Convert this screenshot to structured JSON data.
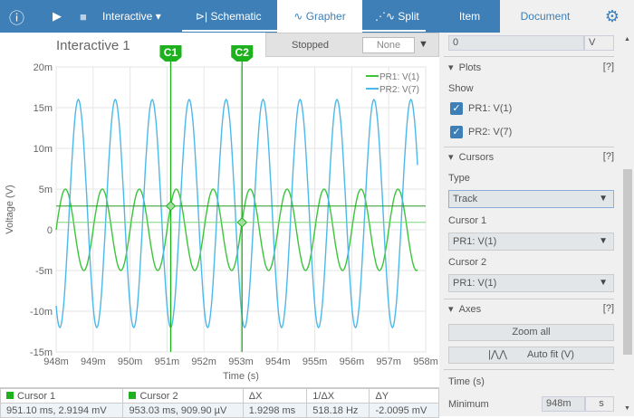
{
  "toolbar": {
    "mode": "Interactive",
    "tabs": [
      "Schematic",
      "Grapher",
      "Split"
    ]
  },
  "right_tabs": {
    "item": "Item",
    "document": "Document"
  },
  "status": {
    "state": "Stopped",
    "select": "None"
  },
  "chart_title": "Interactive 1",
  "cursors": {
    "c1": "C1",
    "c2": "C2"
  },
  "chart_data": {
    "type": "line",
    "xlabel": "Time (s)",
    "ylabel": "Voltage (V)",
    "xlim": [
      0.948,
      0.958
    ],
    "ylim": [
      -0.015,
      0.02
    ],
    "xticks": [
      "948m",
      "949m",
      "950m",
      "951m",
      "952m",
      "953m",
      "954m",
      "955m",
      "956m",
      "957m",
      "958m"
    ],
    "yticks": [
      "20m",
      "15m",
      "10m",
      "5m",
      "0",
      "-5m",
      "-10m",
      "-15m"
    ],
    "grid": true,
    "legend": "top-right",
    "x_end": 0.9578,
    "series": [
      {
        "name": "PR1: V(1)",
        "color": "#3cc43c",
        "model": "sine",
        "offset_mV": 0,
        "amplitude_mV": 5,
        "frequency_hz": 1000,
        "phase_zero_s": 0.948
      },
      {
        "name": "PR2: V(7)",
        "color": "#4db8ea",
        "model": "cosine",
        "offset_mV": 2,
        "amplitude_mV": 14,
        "frequency_hz": 1000,
        "peak_at_s": 0.9486
      }
    ],
    "cursor_values": [
      {
        "t_ms": 951.1,
        "v_mV": 2.9194
      },
      {
        "t_ms": 953.03,
        "v_mV": 0.9099
      }
    ]
  },
  "table": {
    "headers": [
      "Cursor 1",
      "Cursor 2",
      "ΔX",
      "1/ΔX",
      "ΔY"
    ],
    "values": [
      "951.10 ms, 2.9194 mV",
      "953.03 ms, 909.90 µV",
      "1.9298 ms",
      "518.18 Hz",
      "-2.0095 mV"
    ]
  },
  "side": {
    "top_value": "0",
    "top_unit": "V",
    "plots": {
      "title": "Plots",
      "help": "[?]",
      "show": "Show",
      "items": [
        "PR1: V(1)",
        "PR2: V(7)"
      ]
    },
    "cursors": {
      "title": "Cursors",
      "help": "[?]",
      "type_label": "Type",
      "type": "Track",
      "c1_label": "Cursor 1",
      "c1": "PR1: V(1)",
      "c2_label": "Cursor 2",
      "c2": "PR1: V(1)"
    },
    "axes": {
      "title": "Axes",
      "help": "[?]",
      "zoom_all": "Zoom all",
      "auto_fit": "Auto fit (V)",
      "time_label": "Time (s)",
      "min_label": "Minimum",
      "min_value": "948m",
      "min_unit": "s"
    }
  }
}
